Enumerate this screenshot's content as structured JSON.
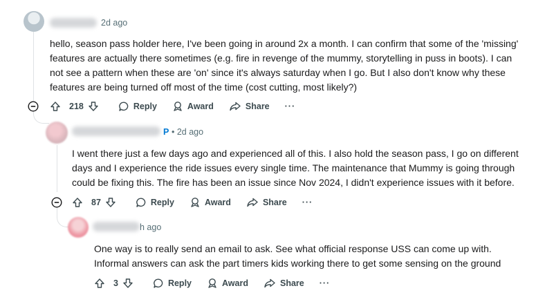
{
  "comments": [
    {
      "time": "2d ago",
      "body": "hello, season pass holder here, I've been going in around 2x a month. I can confirm that some of the 'missing' features are actually there sometimes (e.g. fire in revenge of the mummy, storytelling in puss in boots). I can not see a pattern when these are 'on' since it's always saturday when I go. But I also don't know why these features are being turned off most of the time (cost cutting, most likely?)",
      "votes": "218",
      "reply_label": "Reply",
      "award_label": "Award",
      "share_label": "Share",
      "more": "···"
    },
    {
      "flair": "P",
      "time": "• 2d ago",
      "body": "I went there just a few days ago and experienced all of this. I also hold the season pass, I go on different days and I experience the ride issues every single time. The maintenance that Mummy is going through could be fixing this. The fire has been an issue since Nov 2024, I didn't experience issues with it before.",
      "votes": "87",
      "reply_label": "Reply",
      "award_label": "Award",
      "share_label": "Share",
      "more": "···"
    },
    {
      "time": "h ago",
      "body": "One way is to really send an email to ask. See what official response USS can come up with. Informal answers can ask the part timers kids working there to get some sensing on the ground",
      "votes": "3",
      "reply_label": "Reply",
      "award_label": "Award",
      "share_label": "Share",
      "more": "···"
    }
  ]
}
